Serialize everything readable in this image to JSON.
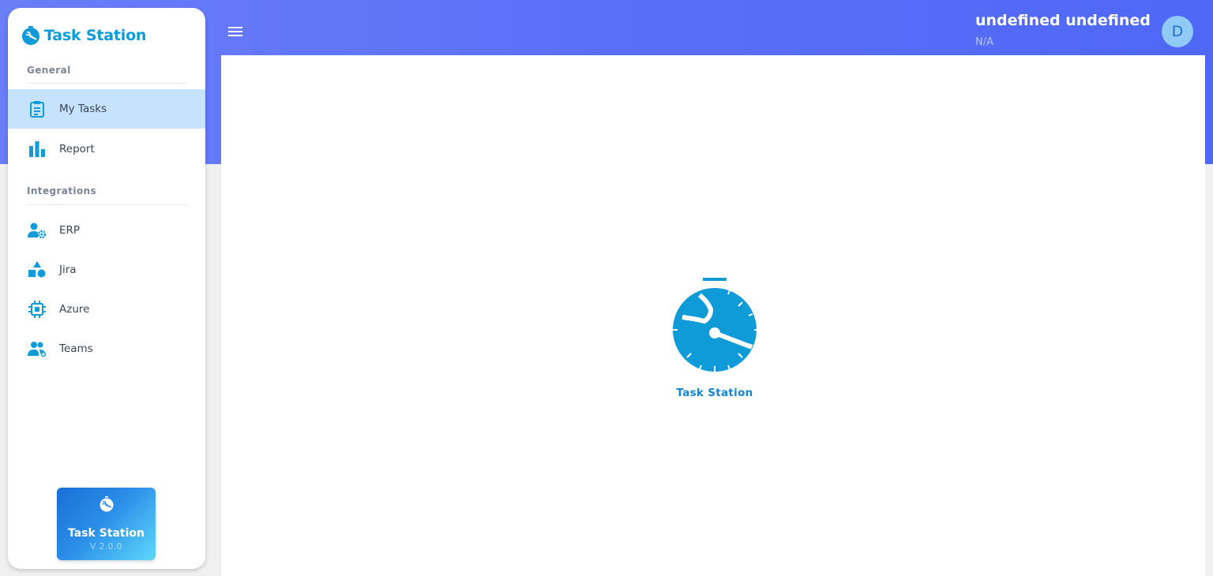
{
  "app": {
    "brand_name": "Task Station",
    "accent_color": "#0f9ad8",
    "header_gradient": [
      "#6a7ef8",
      "#4f68f6"
    ]
  },
  "sidebar": {
    "sections": [
      {
        "title": "General",
        "items": [
          {
            "label": "My Tasks",
            "icon": "clipboard-icon",
            "active": true
          },
          {
            "label": "Report",
            "icon": "bar-chart-icon",
            "active": false
          }
        ]
      },
      {
        "title": "Integrations",
        "items": [
          {
            "label": "ERP",
            "icon": "user-gear-icon",
            "active": false
          },
          {
            "label": "Jira",
            "icon": "shapes-icon",
            "active": false
          },
          {
            "label": "Azure",
            "icon": "chip-icon",
            "active": false
          },
          {
            "label": "Teams",
            "icon": "users-icon",
            "active": false
          }
        ]
      }
    ],
    "version_card": {
      "title": "Task Station",
      "version": "V 2.0.0",
      "icon": "stopwatch-icon"
    }
  },
  "header": {
    "menu_icon": "hamburger-menu-icon",
    "user_name": "undefined undefined",
    "user_role": "N/A",
    "avatar_initial": "D"
  },
  "main": {
    "loader_icon": "stopwatch-icon",
    "loader_label": "Task Station"
  }
}
